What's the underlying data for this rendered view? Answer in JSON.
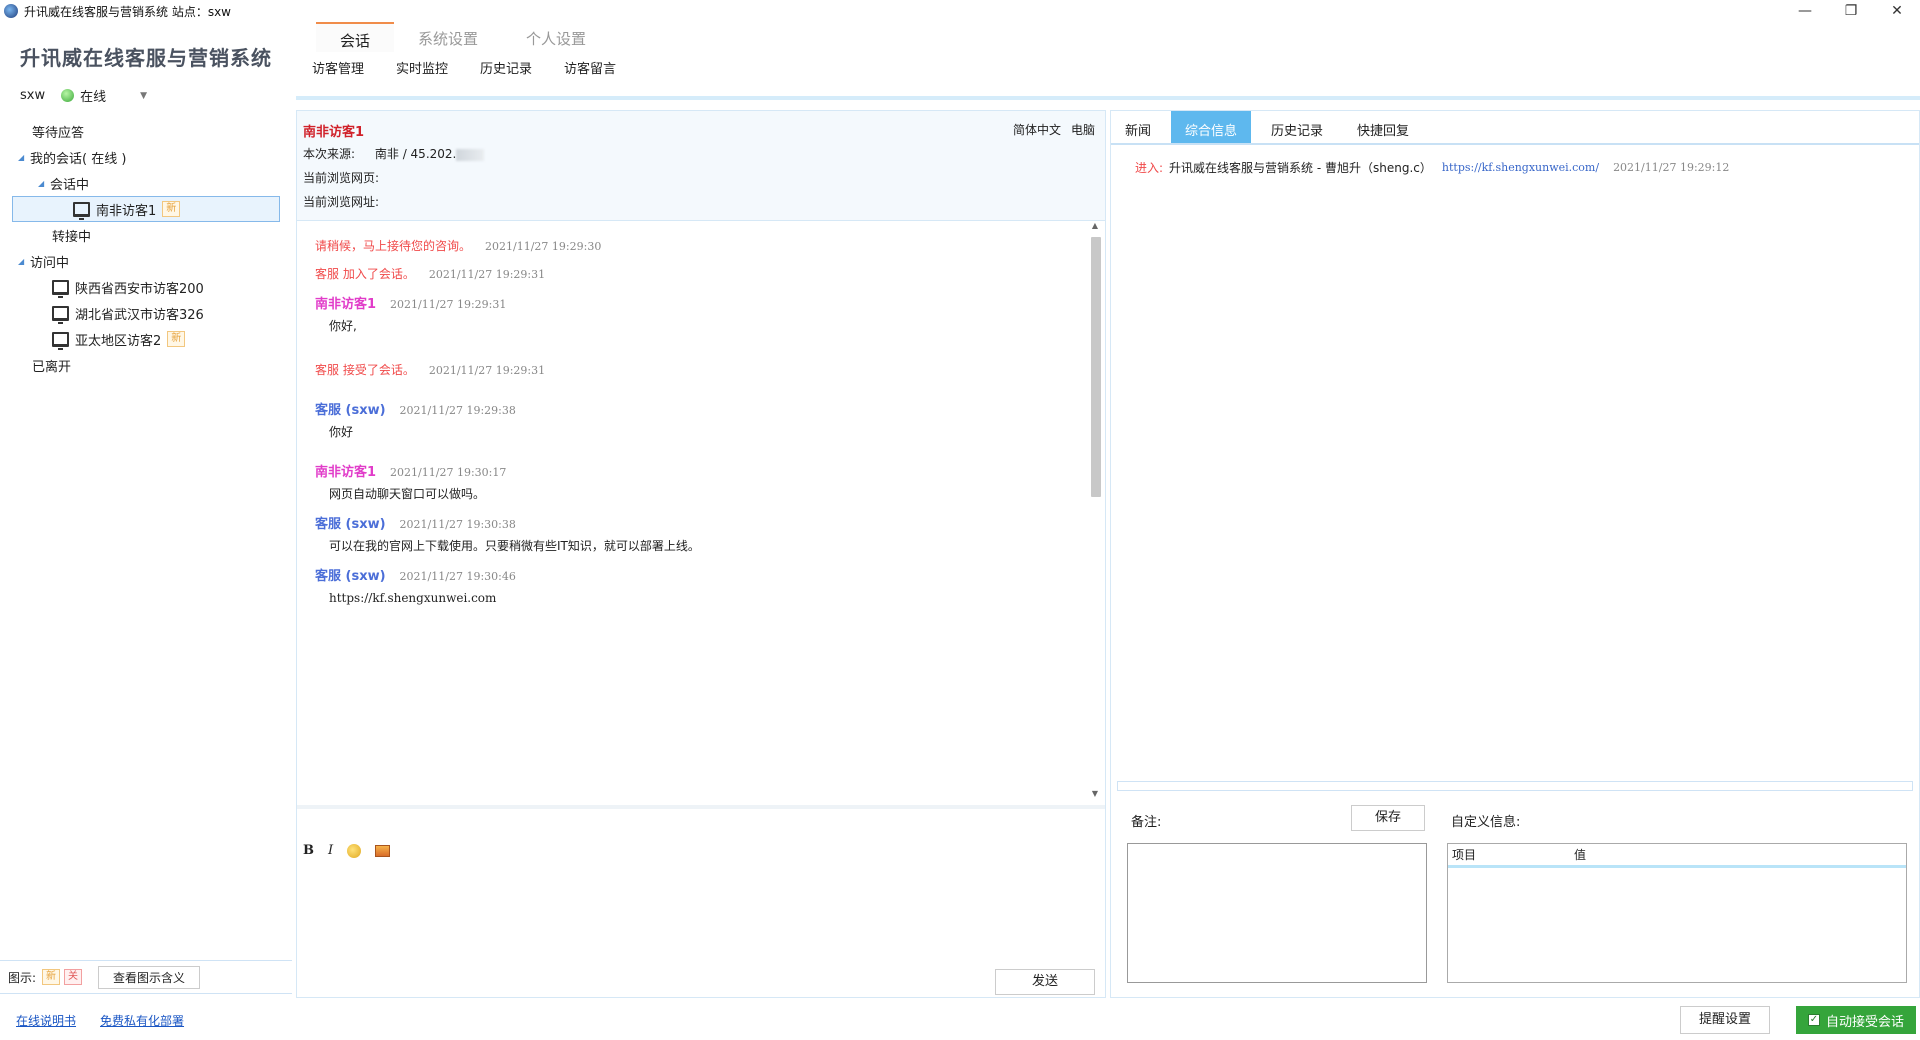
{
  "window": {
    "title": "升讯威在线客服与营销系统  站点：sxw"
  },
  "left": {
    "brand": "升讯威在线客服与营销系统",
    "user": "sxw",
    "status": "在线",
    "tree": {
      "waiting": "等待应答",
      "my_sessions": "我的会话( 在线 )",
      "in_session": "会话中",
      "visitor_selected": "南非访客1",
      "transferring": "转接中",
      "visiting": "访问中",
      "visitors": [
        {
          "name": "陕西省西安市访客200"
        },
        {
          "name": "湖北省武汉市访客326"
        },
        {
          "name": "亚太地区访客2"
        }
      ],
      "left": "已离开"
    },
    "badge_new": "新",
    "badge_off": "关",
    "legend_label": "图示:",
    "legend_button": "查看图示含义",
    "links": {
      "manual": "在线说明书",
      "deploy": "免费私有化部署"
    }
  },
  "tabs": {
    "main": [
      "会话",
      "系统设置",
      "个人设置"
    ],
    "sub": [
      "访客管理",
      "实时监控",
      "历史记录",
      "访客留言"
    ]
  },
  "visitor_info": {
    "name": "南非访客1",
    "lang": "简体中文",
    "device": "电脑",
    "source_label": "本次来源:",
    "source_value": "南非  /  45.202.",
    "page_label": "当前浏览网页:",
    "url_label": "当前浏览网址:"
  },
  "messages": {
    "m1_text": "请稍候，马上接待您的咨询。",
    "m1_time": "2021/11/27 19:29:30",
    "m2_text": "客服 加入了会话。",
    "m2_time": "2021/11/27 19:29:31",
    "m3_sender": "南非访客1",
    "m3_time": "2021/11/27 19:29:31",
    "m3_body": "你好,",
    "m4_text": "客服 接受了会话。",
    "m4_time": "2021/11/27 19:29:31",
    "m5_sender": "客服 (sxw)",
    "m5_time": "2021/11/27 19:29:38",
    "m5_body": "你好",
    "m6_sender": "南非访客1",
    "m6_time": "2021/11/27 19:30:17",
    "m6_body": "网页自动聊天窗口可以做吗。",
    "m7_sender": "客服 (sxw)",
    "m7_time": "2021/11/27 19:30:38",
    "m7_body": "可以在我的官网上下载使用。只要稍微有些IT知识，就可以部署上线。",
    "m8_sender": "客服 (sxw)",
    "m8_time": "2021/11/27 19:30:46",
    "m8_body": "https://kf.shengxunwei.com"
  },
  "editor": {
    "send": "发送"
  },
  "right": {
    "tabs": [
      "新闻",
      "综合信息",
      "历史记录",
      "快捷回复"
    ],
    "enter_label": "进入:",
    "enter_text": "升讯威在线客服与营销系统 - 曹旭升（sheng.c）",
    "enter_link": "https://kf.shengxunwei.com/",
    "enter_time": "2021/11/27 19:29:12",
    "note_label": "备注:",
    "save": "保存",
    "custom_label": "自定义信息:",
    "col_item": "项目",
    "col_value": "值"
  },
  "footer": {
    "remind": "提醒设置",
    "auto_accept": "自动接受会话"
  },
  "colors": {
    "accent": "#5eb8ee",
    "green": "#35a53b",
    "visitor": "#e13cc9",
    "agent": "#4b6ed8",
    "system": "#f04a4a"
  }
}
